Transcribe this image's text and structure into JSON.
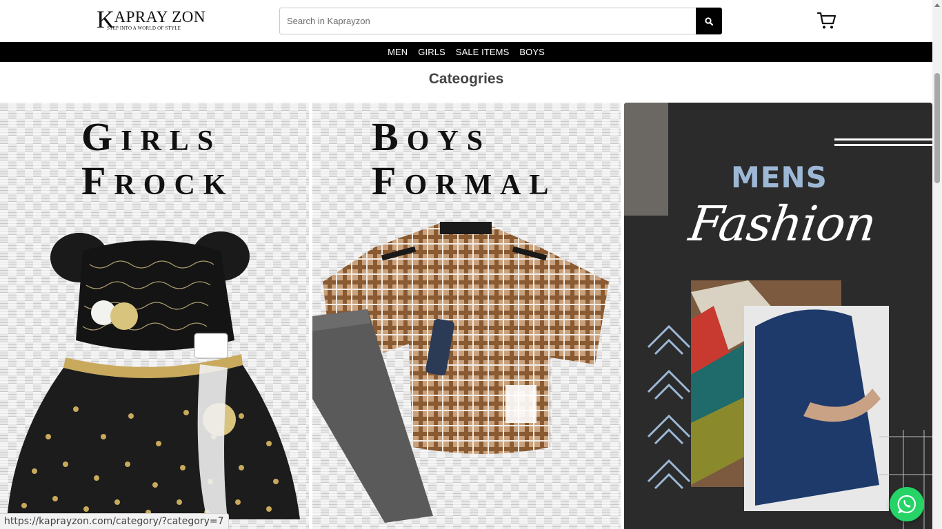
{
  "brand": {
    "logo_text": "APRAY ZON",
    "logo_initial": "K",
    "tagline": "STEP INTO A WORLD OF STYLE"
  },
  "search": {
    "placeholder": "Search in Kaprayzon",
    "icon": "search-icon"
  },
  "cart": {
    "icon": "cart-icon"
  },
  "nav": {
    "items": [
      {
        "label": "MEN"
      },
      {
        "label": "GIRLS"
      },
      {
        "label": "SALE ITEMS"
      },
      {
        "label": "BOYS"
      }
    ]
  },
  "categories": {
    "title": "Cateogries",
    "cards": [
      {
        "line1_cap": "G",
        "line1_rest": "IRLS",
        "line2_cap": "F",
        "line2_rest": "ROCK"
      },
      {
        "line1_cap": "B",
        "line1_rest": "OYS",
        "line2_cap": "F",
        "line2_rest": "ORMAL"
      },
      {
        "title": "MENS",
        "script": "Fashion"
      }
    ]
  },
  "status_bar": {
    "url": "https://kaprayzon.com/category/?category=7"
  },
  "colors": {
    "nav_bg": "#000000",
    "mens_title": "#9db8d6",
    "whatsapp": "#25d366"
  }
}
